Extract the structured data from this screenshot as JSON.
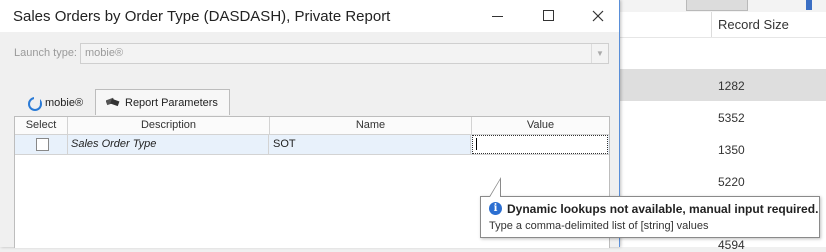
{
  "dialog": {
    "title": "Sales Orders by Order Type (DASDASH), Private Report",
    "launch_type_label": "Launch type:",
    "launch_type_value": "mobie®",
    "tabs": [
      {
        "label": "mobie®",
        "icon": "mobie-icon"
      },
      {
        "label": "Report Parameters",
        "icon": "parameters-icon"
      }
    ],
    "grid": {
      "columns": [
        "Select",
        "Description",
        "Name",
        "Value"
      ],
      "rows": [
        {
          "select": false,
          "description": "Sales Order Type",
          "name": "SOT",
          "value": ""
        }
      ]
    },
    "tooltip": {
      "title": "Dynamic lookups not available, manual input required.",
      "text": "Type a comma-delimited list of [string] values"
    }
  },
  "background": {
    "column_header": "Record Size",
    "values": [
      "1282",
      "5352",
      "1350",
      "5220",
      "4594"
    ]
  },
  "colors": {
    "accent": "#2c6fd1",
    "selected_row": "#e8f1fb"
  }
}
